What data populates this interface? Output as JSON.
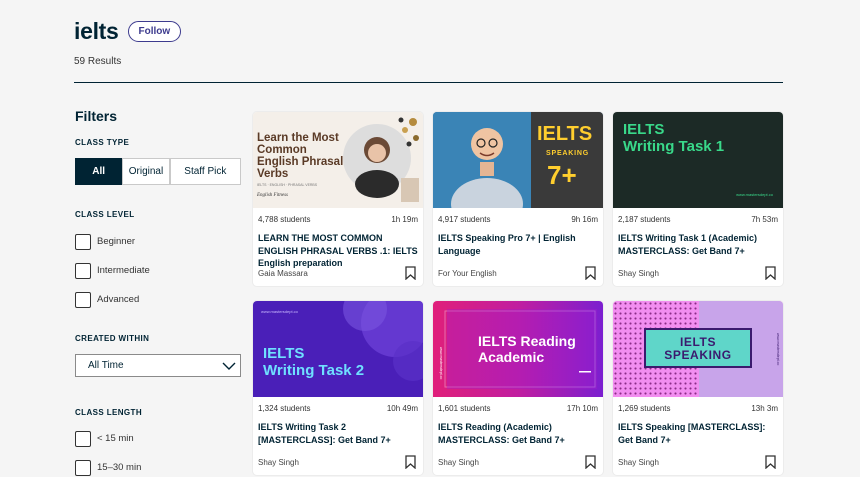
{
  "search": {
    "title": "ielts",
    "follow_label": "Follow",
    "results": "59 Results"
  },
  "filters": {
    "title": "Filters",
    "class_type": {
      "title": "CLASS TYPE",
      "options": [
        "All",
        "Original",
        "Staff Pick"
      ],
      "selected": "All"
    },
    "class_level": {
      "title": "CLASS LEVEL",
      "options": [
        "Beginner",
        "Intermediate",
        "Advanced"
      ]
    },
    "created_within": {
      "title": "CREATED WITHIN",
      "value": "All Time"
    },
    "class_length": {
      "title": "CLASS LENGTH",
      "options": [
        "< 15 min",
        "15–30 min"
      ]
    }
  },
  "cards": [
    {
      "students": "4,788 students",
      "duration": "1h 19m",
      "title": "LEARN THE MOST COMMON ENGLISH PHRASAL VERBS .1: IELTS English preparation",
      "teacher": "Gaia Massara",
      "thumb": {
        "headline": "Learn the Most Common English Phrasal Verbs",
        "small": "IELTS · ENGLISH · PHRASAL VERBS",
        "sign": "English Fitness"
      }
    },
    {
      "students": "4,917 students",
      "duration": "9h 16m",
      "title": "IELTS Speaking Pro 7+ | English Language",
      "teacher": "For Your English",
      "thumb": {
        "line1": "IELTS",
        "line2": "SPEAKING",
        "line3": "7+"
      }
    },
    {
      "students": "2,187 students",
      "duration": "7h 53m",
      "title": "IELTS Writing Task 1 (Academic) MASTERCLASS: Get Band 7+",
      "teacher": "Shay Singh",
      "thumb": {
        "line1": "IELTS",
        "line2": "Writing Task 1",
        "url": "www.mastersdept.co"
      }
    },
    {
      "students": "1,324 students",
      "duration": "10h 49m",
      "title": "IELTS Writing Task 2 [MASTERCLASS]: Get Band 7+",
      "teacher": "Shay Singh",
      "thumb": {
        "line1": "IELTS",
        "line2": "Writing Task 2",
        "url": "www.mastersdept.co"
      }
    },
    {
      "students": "1,601 students",
      "duration": "17h 10m",
      "title": "IELTS Reading (Academic) MASTERCLASS: Get Band 7+",
      "teacher": "Shay Singh",
      "thumb": {
        "line1": "IELTS Reading",
        "line2": "Academic",
        "url": "www.mastersdept.co"
      }
    },
    {
      "students": "1,269 students",
      "duration": "13h 3m",
      "title": "IELTS Speaking [MASTERCLASS]: Get Band 7+",
      "teacher": "Shay Singh",
      "thumb": {
        "line1": "IELTS",
        "line2": "SPEAKING",
        "url": "www.mastersdept.co"
      }
    }
  ]
}
